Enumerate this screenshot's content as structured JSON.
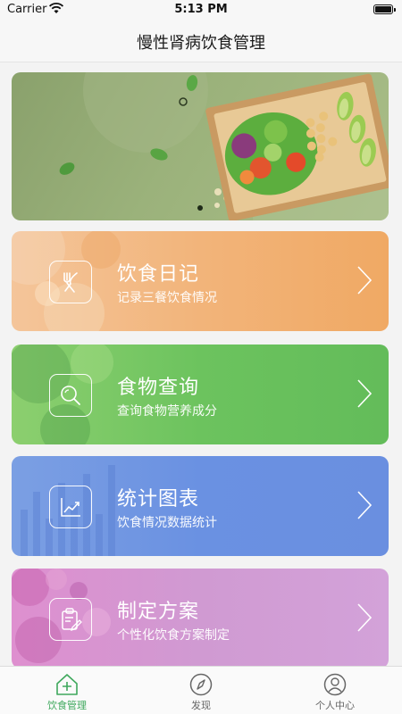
{
  "status_bar": {
    "carrier": "Carrier",
    "time": "5:13 PM"
  },
  "nav": {
    "title": "慢性肾病饮食管理"
  },
  "cards": [
    {
      "title": "饮食日记",
      "subtitle": "记录三餐饮食情况",
      "icon": "fork-knife-icon",
      "color": "#f2b47a"
    },
    {
      "title": "食物查询",
      "subtitle": "查询食物营养成分",
      "icon": "search-icon",
      "color": "#6cc35e"
    },
    {
      "title": "统计图表",
      "subtitle": "饮食情况数据统计",
      "icon": "line-chart-icon",
      "color": "#6a91e2"
    },
    {
      "title": "制定方案",
      "subtitle": "个性化饮食方案制定",
      "icon": "clipboard-edit-icon",
      "color": "#d09ad2"
    }
  ],
  "tabs": [
    {
      "label": "饮食管理",
      "icon": "home-plus-icon",
      "active": true,
      "color": "#3ea85c"
    },
    {
      "label": "发现",
      "icon": "compass-icon",
      "active": false,
      "color": "#666666"
    },
    {
      "label": "个人中心",
      "icon": "user-icon",
      "active": false,
      "color": "#666666"
    }
  ]
}
